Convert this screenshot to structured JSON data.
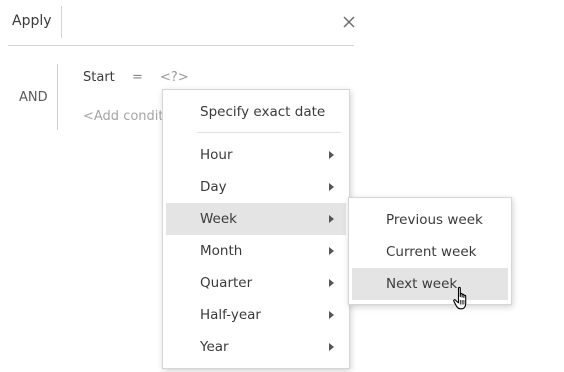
{
  "toolbar": {
    "apply_label": "Apply"
  },
  "filter": {
    "group_operator": "AND",
    "condition": {
      "field": "Start",
      "operator": "=",
      "value": "<?>"
    },
    "add_condition_placeholder": "<Add conditi"
  },
  "date_menu": {
    "exact_date_label": "Specify exact date",
    "items": [
      {
        "label": "Hour"
      },
      {
        "label": "Day"
      },
      {
        "label": "Week"
      },
      {
        "label": "Month"
      },
      {
        "label": "Quarter"
      },
      {
        "label": "Half-year"
      },
      {
        "label": "Year"
      }
    ],
    "highlighted": "Week"
  },
  "week_submenu": {
    "items": [
      {
        "label": "Previous week"
      },
      {
        "label": "Current week"
      },
      {
        "label": "Next week"
      }
    ],
    "highlighted": "Next week"
  },
  "colors": {
    "highlight": "#e4e4e4",
    "border": "#d6d6d6",
    "text": "#3b3b3b",
    "muted_text": "#a5a5a5"
  },
  "icons": [
    "close-icon",
    "submenu-arrow-icon",
    "hand-cursor-icon"
  ]
}
